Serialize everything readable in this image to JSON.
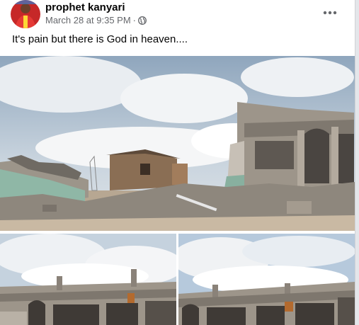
{
  "post": {
    "author": "prophet kanyari",
    "timestamp": "March 28 at 9:35 PM",
    "separator": "·",
    "audience_icon": "globe-icon",
    "more_icon": "more-horizontal-icon",
    "caption": "It's pain but there is God in heaven....",
    "photos": [
      {
        "subject": "demolished church ruins with rubble"
      },
      {
        "subject": "church ruins, left view"
      },
      {
        "subject": "church ruins, right view"
      }
    ]
  },
  "colors": {
    "author_text": "#050505",
    "meta_text": "#65676b",
    "background": "#e4e6ea"
  }
}
